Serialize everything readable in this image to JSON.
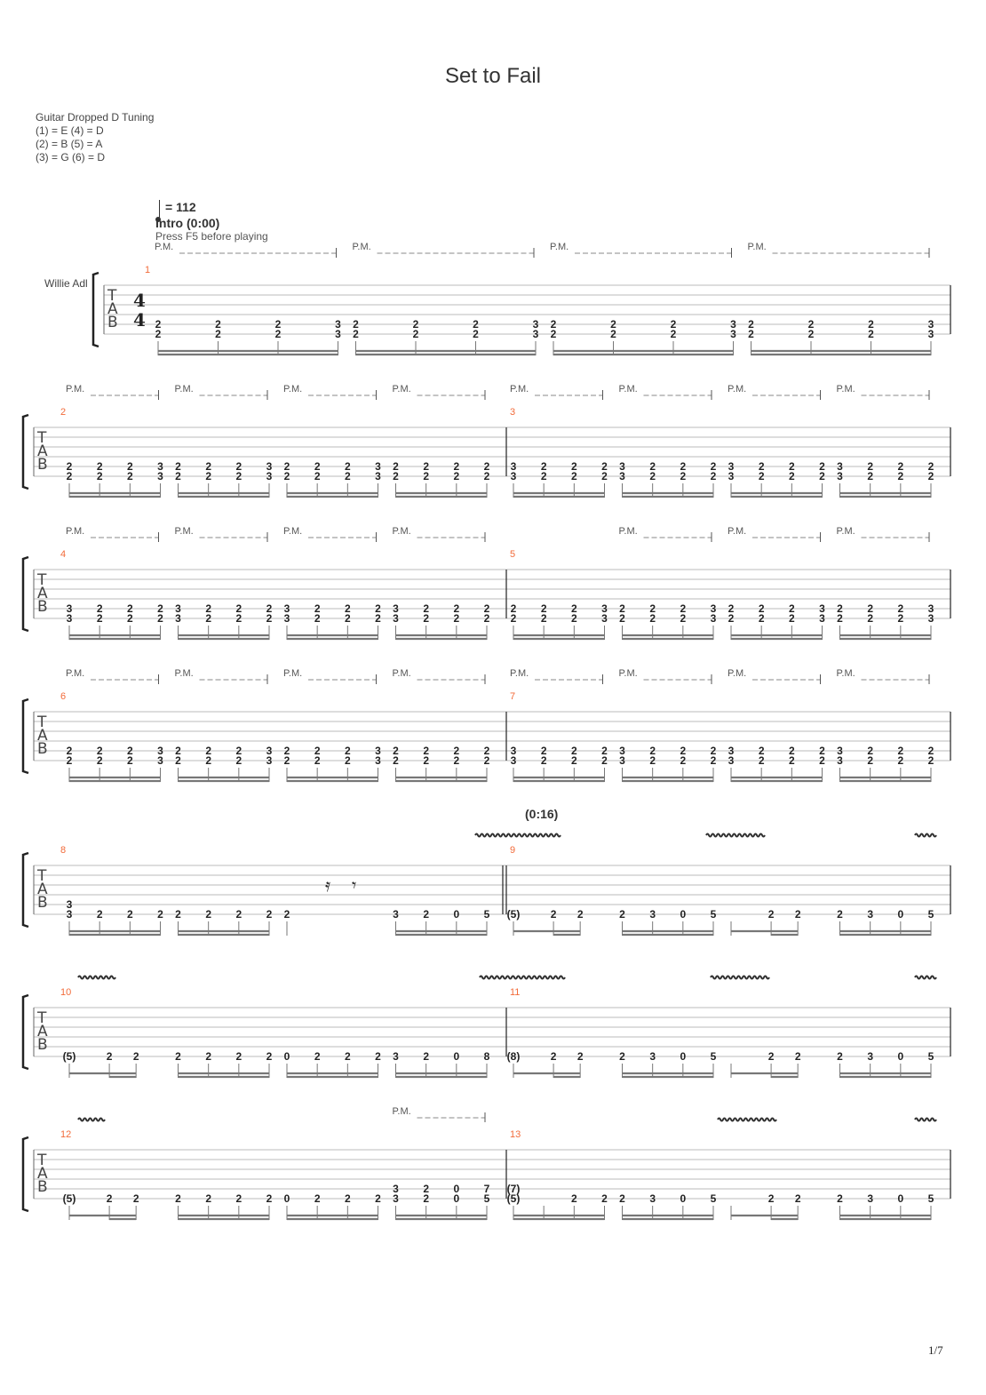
{
  "title": "Set to Fail",
  "tuning": {
    "name": "Guitar Dropped D Tuning",
    "lines": [
      "(1) = E (4) = D",
      "(2) = B (5) = A",
      "(3) = G (6) = D"
    ]
  },
  "tempo": "= 112",
  "section": "Intro (0:00)",
  "instruction": "Press F5 before playing",
  "track_name": "Willie Adl",
  "section_time": "(0:16)",
  "time_signature": [
    "4",
    "4"
  ],
  "palm_mute_label": "P.M.",
  "page": "1/7",
  "colors": {
    "measure_number": "#f26b3a",
    "staff_line": "#bbbbbb",
    "notes": "#222222"
  },
  "systems": [
    {
      "measures": [
        1
      ]
    },
    {
      "measures": [
        2,
        3
      ]
    },
    {
      "measures": [
        4,
        5
      ]
    },
    {
      "measures": [
        6,
        7
      ]
    },
    {
      "measures": [
        8,
        9
      ]
    },
    {
      "measures": [
        10,
        11
      ]
    },
    {
      "measures": [
        12,
        13
      ]
    }
  ],
  "measures": {
    "1": {
      "groups": [
        [
          [
            "2",
            "2"
          ],
          [
            "2",
            "2"
          ],
          [
            "2",
            "2"
          ],
          [
            "3",
            "3"
          ]
        ],
        [
          [
            "2",
            "2"
          ],
          [
            "2",
            "2"
          ],
          [
            "2",
            "2"
          ],
          [
            "3",
            "3"
          ]
        ],
        [
          [
            "2",
            "2"
          ],
          [
            "2",
            "2"
          ],
          [
            "2",
            "2"
          ],
          [
            "3",
            "3"
          ]
        ],
        [
          [
            "2",
            "2"
          ],
          [
            "2",
            "2"
          ],
          [
            "2",
            "2"
          ],
          [
            "3",
            "3"
          ]
        ]
      ],
      "pm": [
        true,
        true,
        true,
        true
      ]
    },
    "2": {
      "groups": [
        [
          [
            "2",
            "2"
          ],
          [
            "2",
            "2"
          ],
          [
            "2",
            "2"
          ],
          [
            "3",
            "3"
          ]
        ],
        [
          [
            "2",
            "2"
          ],
          [
            "2",
            "2"
          ],
          [
            "2",
            "2"
          ],
          [
            "3",
            "3"
          ]
        ],
        [
          [
            "2",
            "2"
          ],
          [
            "2",
            "2"
          ],
          [
            "2",
            "2"
          ],
          [
            "3",
            "3"
          ]
        ],
        [
          [
            "2",
            "2"
          ],
          [
            "2",
            "2"
          ],
          [
            "2",
            "2"
          ],
          [
            "2",
            "2"
          ]
        ]
      ],
      "pm": [
        true,
        true,
        true,
        true
      ]
    },
    "3": {
      "groups": [
        [
          [
            "3",
            "3"
          ],
          [
            "2",
            "2"
          ],
          [
            "2",
            "2"
          ],
          [
            "2",
            "2"
          ]
        ],
        [
          [
            "3",
            "3"
          ],
          [
            "2",
            "2"
          ],
          [
            "2",
            "2"
          ],
          [
            "2",
            "2"
          ]
        ],
        [
          [
            "3",
            "3"
          ],
          [
            "2",
            "2"
          ],
          [
            "2",
            "2"
          ],
          [
            "2",
            "2"
          ]
        ],
        [
          [
            "3",
            "3"
          ],
          [
            "2",
            "2"
          ],
          [
            "2",
            "2"
          ],
          [
            "2",
            "2"
          ]
        ]
      ],
      "pm": [
        true,
        true,
        true,
        true
      ]
    },
    "4": {
      "groups": [
        [
          [
            "3",
            "3"
          ],
          [
            "2",
            "2"
          ],
          [
            "2",
            "2"
          ],
          [
            "2",
            "2"
          ]
        ],
        [
          [
            "3",
            "3"
          ],
          [
            "2",
            "2"
          ],
          [
            "2",
            "2"
          ],
          [
            "2",
            "2"
          ]
        ],
        [
          [
            "3",
            "3"
          ],
          [
            "2",
            "2"
          ],
          [
            "2",
            "2"
          ],
          [
            "2",
            "2"
          ]
        ],
        [
          [
            "3",
            "3"
          ],
          [
            "2",
            "2"
          ],
          [
            "2",
            "2"
          ],
          [
            "2",
            "2"
          ]
        ]
      ],
      "pm": [
        true,
        true,
        true,
        true
      ]
    },
    "5": {
      "groups": [
        [
          [
            "2",
            "2"
          ],
          [
            "2",
            "2"
          ],
          [
            "2",
            "2"
          ],
          [
            "3",
            "3"
          ]
        ],
        [
          [
            "2",
            "2"
          ],
          [
            "2",
            "2"
          ],
          [
            "2",
            "2"
          ],
          [
            "3",
            "3"
          ]
        ],
        [
          [
            "2",
            "2"
          ],
          [
            "2",
            "2"
          ],
          [
            "2",
            "2"
          ],
          [
            "3",
            "3"
          ]
        ],
        [
          [
            "2",
            "2"
          ],
          [
            "2",
            "2"
          ],
          [
            "2",
            "2"
          ],
          [
            "3",
            "3"
          ]
        ]
      ],
      "pm": [
        false,
        true,
        true,
        true
      ]
    },
    "6": {
      "groups": [
        [
          [
            "2",
            "2"
          ],
          [
            "2",
            "2"
          ],
          [
            "2",
            "2"
          ],
          [
            "3",
            "3"
          ]
        ],
        [
          [
            "2",
            "2"
          ],
          [
            "2",
            "2"
          ],
          [
            "2",
            "2"
          ],
          [
            "3",
            "3"
          ]
        ],
        [
          [
            "2",
            "2"
          ],
          [
            "2",
            "2"
          ],
          [
            "2",
            "2"
          ],
          [
            "3",
            "3"
          ]
        ],
        [
          [
            "2",
            "2"
          ],
          [
            "2",
            "2"
          ],
          [
            "2",
            "2"
          ],
          [
            "2",
            "2"
          ]
        ]
      ],
      "pm": [
        true,
        true,
        true,
        true
      ]
    },
    "7": {
      "groups": [
        [
          [
            "3",
            "3"
          ],
          [
            "2",
            "2"
          ],
          [
            "2",
            "2"
          ],
          [
            "2",
            "2"
          ]
        ],
        [
          [
            "3",
            "3"
          ],
          [
            "2",
            "2"
          ],
          [
            "2",
            "2"
          ],
          [
            "2",
            "2"
          ]
        ],
        [
          [
            "3",
            "3"
          ],
          [
            "2",
            "2"
          ],
          [
            "2",
            "2"
          ],
          [
            "2",
            "2"
          ]
        ],
        [
          [
            "3",
            "3"
          ],
          [
            "2",
            "2"
          ],
          [
            "2",
            "2"
          ],
          [
            "2",
            "2"
          ]
        ]
      ],
      "pm": [
        true,
        true,
        true,
        true
      ]
    },
    "8": {
      "groups": [
        [
          [
            "3",
            "3"
          ],
          [
            "",
            "2"
          ],
          [
            "",
            "2"
          ],
          [
            "",
            "2"
          ]
        ],
        [
          [
            "",
            "2"
          ],
          [
            "",
            "2"
          ],
          [
            "",
            "2"
          ],
          [
            "",
            "2"
          ]
        ],
        [
          [
            "",
            "2"
          ]
        ],
        [
          [
            "",
            "3"
          ],
          [
            "",
            "2"
          ],
          [
            "",
            "0"
          ],
          [
            "",
            "5"
          ]
        ]
      ]
    },
    "9": {
      "groups": [
        [
          [
            "",
            "(5)"
          ],
          [
            "",
            "2"
          ],
          [
            "",
            "2"
          ]
        ],
        [
          [
            "",
            "2"
          ],
          [
            "",
            "3"
          ],
          [
            "",
            "0"
          ],
          [
            "",
            "5"
          ]
        ],
        [
          [
            "",
            ""
          ],
          [
            "",
            "2"
          ],
          [
            "",
            "2"
          ]
        ],
        [
          [
            "",
            "2"
          ],
          [
            "",
            "3"
          ],
          [
            "",
            "0"
          ],
          [
            "",
            "5"
          ]
        ]
      ]
    },
    "10": {
      "groups": [
        [
          [
            "",
            "(5)"
          ],
          [
            "",
            "2"
          ],
          [
            "",
            "2"
          ]
        ],
        [
          [
            "",
            "2"
          ],
          [
            "",
            "2"
          ],
          [
            "",
            "2"
          ],
          [
            "",
            "2"
          ]
        ],
        [
          [
            "",
            "0"
          ],
          [
            "",
            "2"
          ],
          [
            "",
            "2"
          ],
          [
            "",
            "2"
          ]
        ],
        [
          [
            "",
            "3"
          ],
          [
            "",
            "2"
          ],
          [
            "",
            "0"
          ],
          [
            "",
            "8"
          ]
        ]
      ]
    },
    "11": {
      "groups": [
        [
          [
            "",
            "(8)"
          ],
          [
            "",
            "2"
          ],
          [
            "",
            "2"
          ]
        ],
        [
          [
            "",
            "2"
          ],
          [
            "",
            "3"
          ],
          [
            "",
            "0"
          ],
          [
            "",
            "5"
          ]
        ],
        [
          [
            "",
            ""
          ],
          [
            "",
            "2"
          ],
          [
            "",
            "2"
          ]
        ],
        [
          [
            "",
            "2"
          ],
          [
            "",
            "3"
          ],
          [
            "",
            "0"
          ],
          [
            "",
            "5"
          ]
        ]
      ]
    },
    "12": {
      "groups": [
        [
          [
            "",
            "(5)"
          ],
          [
            "",
            "2"
          ],
          [
            "",
            "2"
          ]
        ],
        [
          [
            "",
            "2"
          ],
          [
            "",
            "2"
          ],
          [
            "",
            "2"
          ],
          [
            "",
            "2"
          ]
        ],
        [
          [
            "",
            "0"
          ],
          [
            "",
            "2"
          ],
          [
            "",
            "2"
          ],
          [
            "",
            "2"
          ]
        ],
        [
          [
            "3",
            "3"
          ],
          [
            "2",
            "2"
          ],
          [
            "0",
            "0"
          ],
          [
            "7",
            "5"
          ]
        ]
      ],
      "pm": [
        false,
        false,
        false,
        true
      ]
    },
    "13": {
      "groups": [
        [
          [
            "(7)",
            "(5)"
          ],
          [
            "",
            ""
          ],
          [
            "",
            "2"
          ],
          [
            "",
            "2"
          ]
        ],
        [
          [
            "",
            "2"
          ],
          [
            "",
            "3"
          ],
          [
            "",
            "0"
          ],
          [
            "",
            "5"
          ]
        ],
        [
          [
            "",
            ""
          ],
          [
            "",
            "2"
          ],
          [
            "",
            "2"
          ]
        ],
        [
          [
            "",
            "2"
          ],
          [
            "",
            "3"
          ],
          [
            "",
            "0"
          ],
          [
            "",
            "5"
          ]
        ]
      ]
    }
  }
}
